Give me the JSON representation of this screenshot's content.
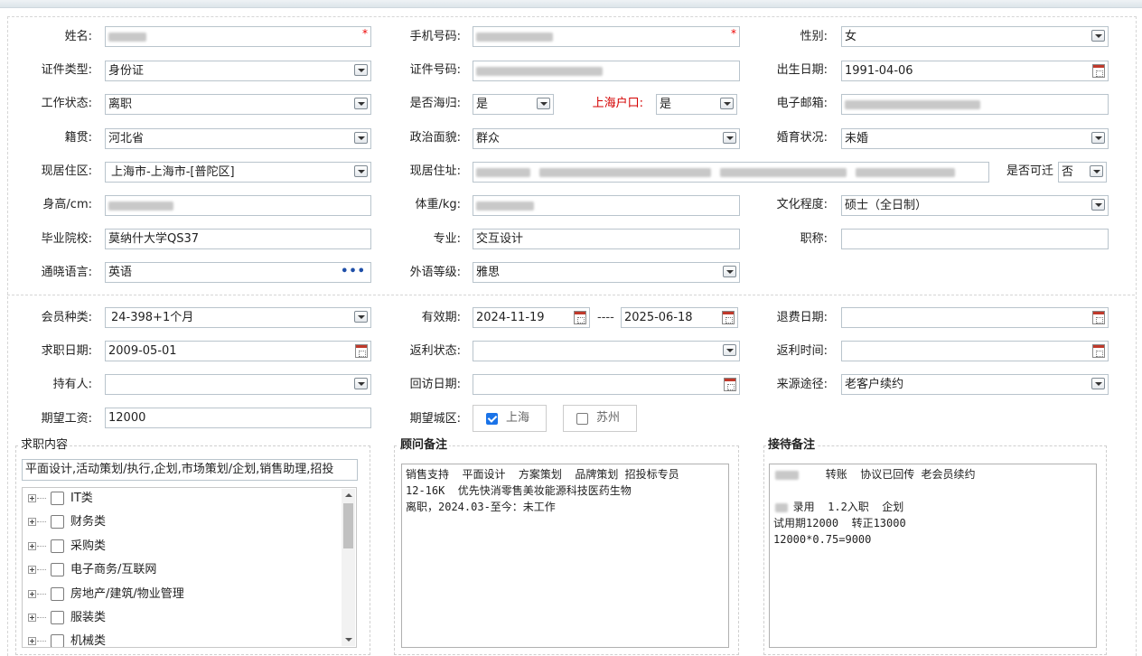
{
  "form": {
    "name": {
      "label": "姓名:",
      "required": "*"
    },
    "phone": {
      "label": "手机号码:",
      "required": "*"
    },
    "gender": {
      "label": "性别:",
      "value": "女"
    },
    "id_type": {
      "label": "证件类型:",
      "value": "身份证"
    },
    "id_number": {
      "label": "证件号码:"
    },
    "birth_date": {
      "label": "出生日期:",
      "value": "1991-04-06"
    },
    "work_status": {
      "label": "工作状态:",
      "value": "离职"
    },
    "returnee": {
      "label": "是否海归:",
      "value": "是"
    },
    "shanghai_hukou": {
      "label": "上海户口:",
      "value": "是"
    },
    "email": {
      "label": "电子邮箱:"
    },
    "native_place": {
      "label": "籍贯:",
      "value": "河北省"
    },
    "political": {
      "label": "政治面貌:",
      "value": "群众"
    },
    "marital": {
      "label": "婚育状况:",
      "value": "未婚"
    },
    "residence_area": {
      "label": "现居住区:",
      "value": "上海市-上海市-[普陀区]"
    },
    "residence_address": {
      "label": "现居住址:"
    },
    "relocate": {
      "label": "是否可迁",
      "value": "否"
    },
    "height": {
      "label": "身高/cm:"
    },
    "weight": {
      "label": "体重/kg:"
    },
    "education": {
      "label": "文化程度:",
      "value": "硕士（全日制）"
    },
    "school": {
      "label": "毕业院校:",
      "value": "莫纳什大学QS37"
    },
    "major": {
      "label": "专业:",
      "value": "交互设计"
    },
    "title": {
      "label": "职称:",
      "value": ""
    },
    "language": {
      "label": "通晓语言:",
      "value": "英语",
      "more": "•••"
    },
    "language_level": {
      "label": "外语等级:",
      "value": "雅思"
    }
  },
  "membership": {
    "member_type": {
      "label": "会员种类:",
      "value": "24-398+1个月"
    },
    "validity": {
      "label": "有效期:",
      "start": "2024-11-19",
      "separator": "----",
      "end": "2025-06-18"
    },
    "refund_date": {
      "label": "退费日期:",
      "value": ""
    },
    "job_date": {
      "label": "求职日期:",
      "value": "2009-05-01"
    },
    "rebate_status": {
      "label": "返利状态:",
      "value": ""
    },
    "rebate_time": {
      "label": "返利时间:",
      "value": ""
    },
    "holder": {
      "label": "持有人:",
      "value": ""
    },
    "revisit_date": {
      "label": "回访日期:",
      "value": ""
    },
    "source": {
      "label": "来源途径:",
      "value": "老客户续约"
    },
    "expected_salary": {
      "label": "期望工资:",
      "value": "12000"
    },
    "expected_city": {
      "label": "期望城区:",
      "options": [
        {
          "label": "上海",
          "checked": true
        },
        {
          "label": "苏州",
          "checked": false
        }
      ]
    }
  },
  "job_content": {
    "title": "求职内容",
    "summary": "平面设计,活动策划/执行,企划,市场策划/企划,销售助理,招投",
    "categories": [
      "IT类",
      "财务类",
      "采购类",
      "电子商务/互联网",
      "房地产/建筑/物业管理",
      "服装类",
      "机械类"
    ]
  },
  "advisor_notes": {
    "title": "顾问备注",
    "text": "销售支持  平面设计  方案策划  品牌策划 招投标专员\n12-16K  优先快消零售美妆能源科技医药生物\n离职，2024.03-至今：未工作"
  },
  "reception_notes": {
    "title": "接待备注",
    "text": "        转账  协议已回传 老会员续约\n\n   录用  1.2入职  企划\n试用期12000  转正13000\n12000*0.75=9000"
  },
  "colors": {
    "border": "#b9c4cc",
    "required": "#e00000",
    "hukou_label": "#d40000",
    "checked": "#1a73e8"
  }
}
